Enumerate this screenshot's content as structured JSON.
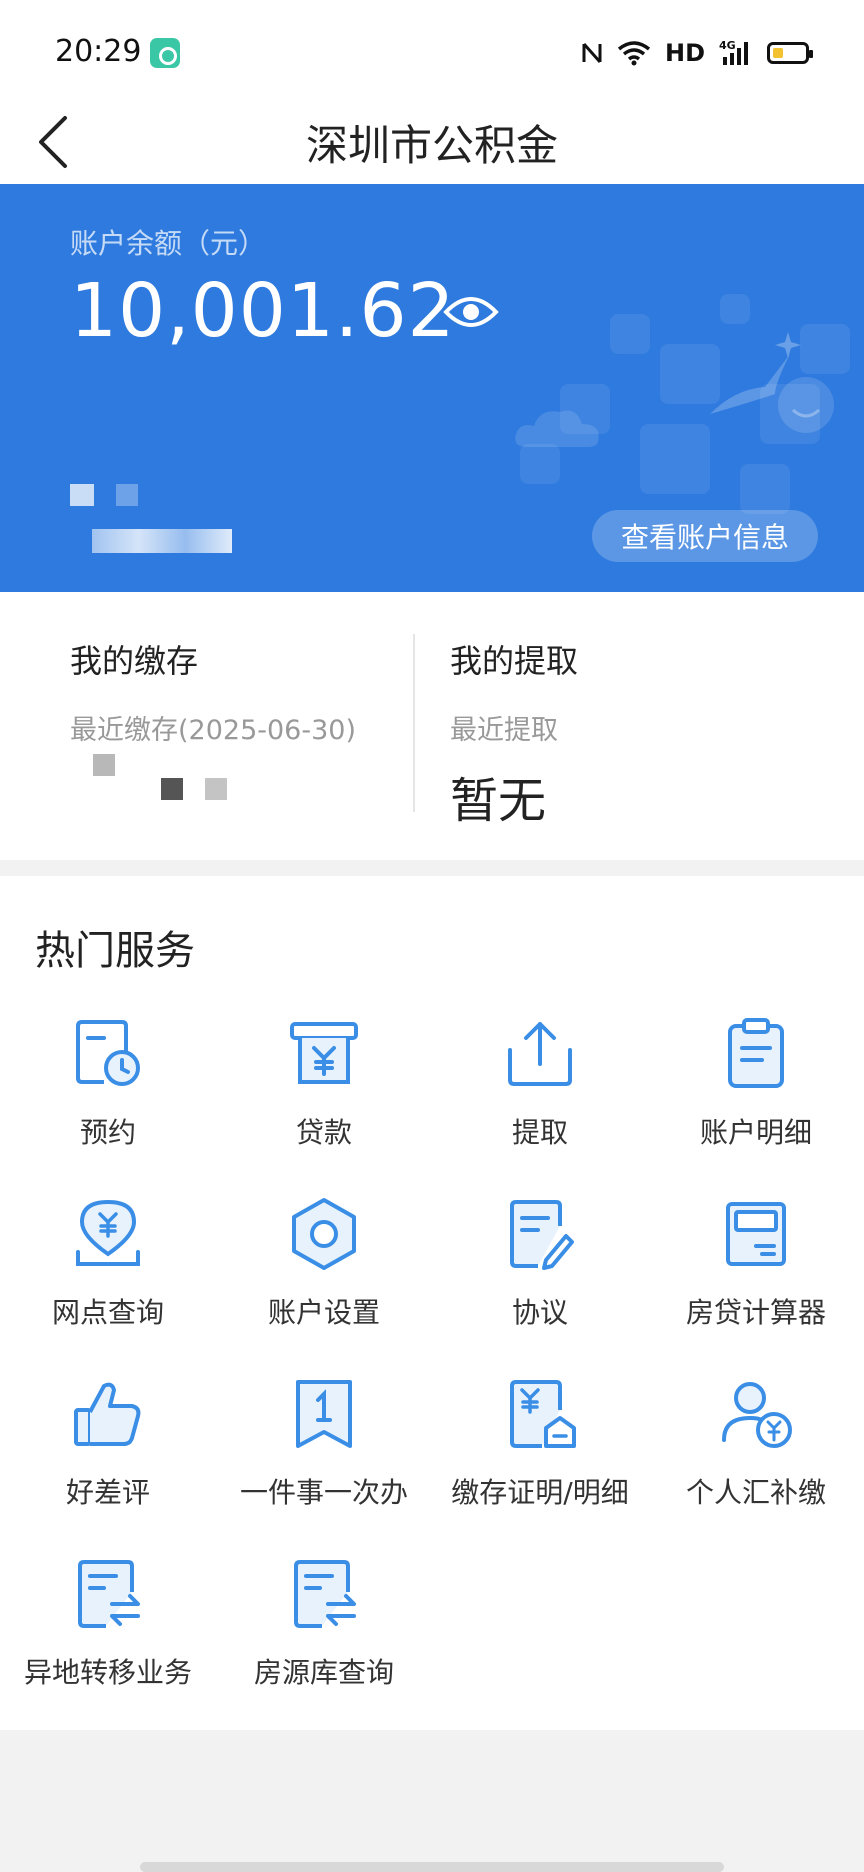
{
  "status_bar": {
    "time": "20:29",
    "hd": "HD",
    "icons": [
      "app-icon",
      "nfc-icon",
      "wifi-icon",
      "signal-4g-icon",
      "battery-icon"
    ]
  },
  "nav": {
    "title": "深圳市公积金",
    "back_icon": "chevron-left-icon"
  },
  "balance": {
    "label": "账户余额（元）",
    "value": "10,001.62",
    "eye_icon": "eye-icon",
    "account_info_button": "查看账户信息"
  },
  "summary": {
    "deposit": {
      "heading": "我的缴存",
      "sub": "最近缴存(2025-06-30)"
    },
    "withdraw": {
      "heading": "我的提取",
      "sub": "最近提取",
      "value": "暂无"
    }
  },
  "services": {
    "title": "热门服务",
    "items": [
      {
        "label": "预约",
        "icon": "calendar-clock-icon"
      },
      {
        "label": "贷款",
        "icon": "yuan-receipt-icon"
      },
      {
        "label": "提取",
        "icon": "upload-icon"
      },
      {
        "label": "账户明细",
        "icon": "clipboard-icon"
      },
      {
        "label": "网点查询",
        "icon": "location-yuan-icon"
      },
      {
        "label": "账户设置",
        "icon": "hexagon-settings-icon"
      },
      {
        "label": "协议",
        "icon": "document-edit-icon"
      },
      {
        "label": "房贷计算器",
        "icon": "calculator-icon"
      },
      {
        "label": "好差评",
        "icon": "thumbs-up-icon"
      },
      {
        "label": "一件事一次办",
        "icon": "bookmark-one-icon"
      },
      {
        "label": "缴存证明/明细",
        "icon": "document-yuan-icon"
      },
      {
        "label": "个人汇补缴",
        "icon": "person-yuan-icon"
      },
      {
        "label": "异地转移业务",
        "icon": "document-transfer-icon"
      },
      {
        "label": "房源库查询",
        "icon": "document-transfer-icon"
      }
    ]
  },
  "colors": {
    "primary": "#2e7ade",
    "icon_blue": "#3a8ee6",
    "background": "#f2f2f2"
  }
}
